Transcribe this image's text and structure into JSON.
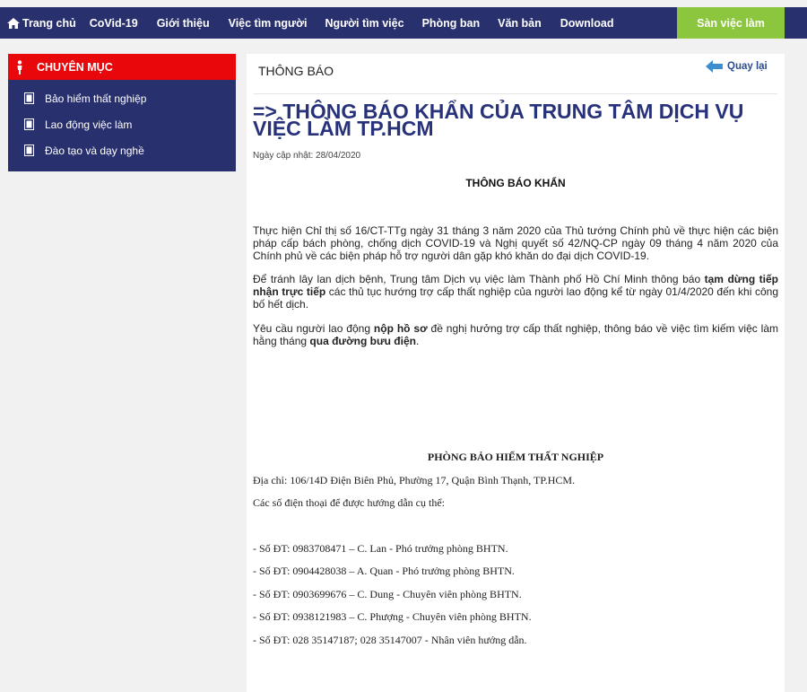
{
  "nav": {
    "items": [
      "Trang chủ",
      "CoVid-19",
      "Giới thiệu",
      "Việc tìm người",
      "Người tìm việc",
      "Phòng ban",
      "Văn bản",
      "Download"
    ],
    "jobs_button": "Sàn việc làm"
  },
  "sidebar": {
    "title": "CHUYÊN MỤC",
    "items": [
      "Bảo hiểm thất nghiệp",
      "Lao động việc làm",
      "Đào tạo và dạy nghề"
    ]
  },
  "content": {
    "section_title": "THÔNG BÁO",
    "back_label": "Quay lại",
    "headline": "=> THÔNG BÁO KHẨN CỦA TRUNG TÂM DỊCH VỤ VIỆC LÀM TP.HCM",
    "updated": "Ngày cập nhật: 28/04/2020",
    "notice_title": "THÔNG BÁO KHẨN",
    "para1": "Thực hiện Chỉ thị số 16/CT-TTg ngày 31 tháng 3 năm 2020 của Thủ tướng Chính phủ về thực hiện các biện pháp cấp bách phòng, chống dịch COVID-19 và Nghị quyết số 42/NQ-CP ngày 09 tháng 4 năm 2020 của Chính phủ về các biện pháp hỗ trợ người dân gặp khó khăn do đại dịch COVID-19.",
    "para2_a": "Để tránh lây lan dịch bệnh, Trung tâm Dịch vụ việc làm Thành phố Hồ Chí Minh thông báo ",
    "para2_b": "tạm dừng tiếp nhận trực tiếp",
    "para2_c": " các thủ tục hướng trợ cấp thất nghiệp của người lao động kể từ ngày 01/4/2020 đến khi công bố hết dịch.",
    "para3_a": "Yêu cầu người lao động ",
    "para3_b": "nộp hồ sơ",
    "para3_c": " đề nghị hưởng trợ cấp thất nghiệp, thông báo về việc tìm kiếm việc làm hằng tháng ",
    "para3_d": "qua đường bưu điện",
    "para3_e": ".",
    "office_title": "PHÒNG BẢO HIỂM THẤT NGHIỆP",
    "address": "Địa chỉ: 106/14D Điện Biên Phủ, Phường 17, Quận Bình Thạnh, TP.HCM.",
    "phones_intro": "Các số điện thoại để được hướng dẫn cụ thể:",
    "phones": [
      "- Số ĐT: 0983708471 – C. Lan - Phó trưởng phòng BHTN.",
      "- Số ĐT: 0904428038 – A. Quan - Phó trưởng phòng BHTN.",
      "- Số ĐT: 0903699676 – C. Dung - Chuyên viên phòng BHTN.",
      "- Số ĐT: 0938121983 – C. Phượng - Chuyên viên phòng BHTN.",
      "- Số ĐT: 028 35147187; 028 35147007 - Nhân viên hướng dẫn."
    ]
  },
  "colors": {
    "nav_bg": "#29306e",
    "accent_red": "#e8070b",
    "jobs_green": "#8cc63f",
    "headline": "#28327a"
  }
}
